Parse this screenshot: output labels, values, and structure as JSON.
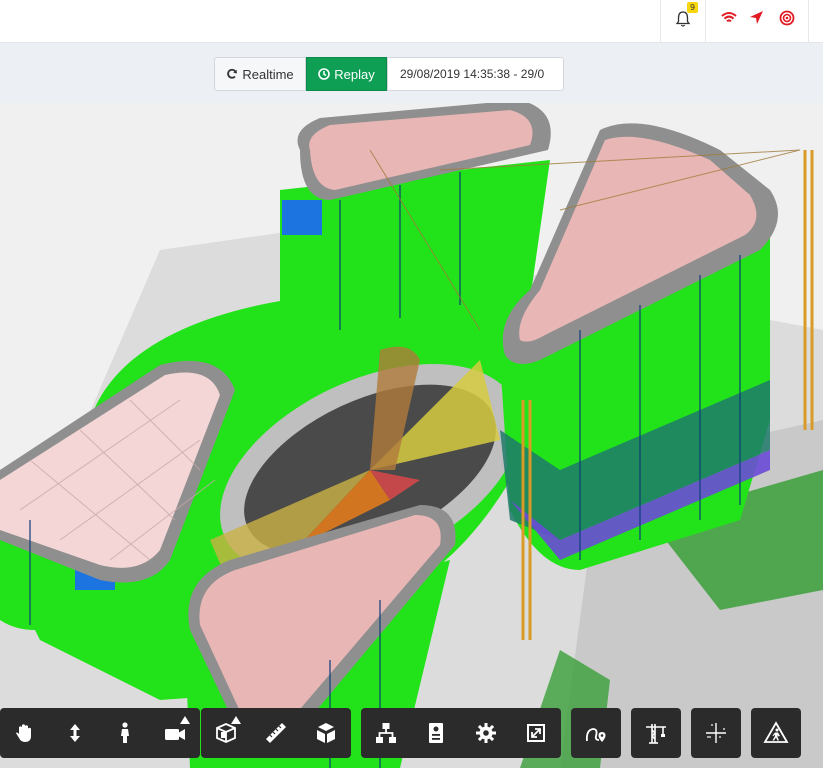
{
  "header": {
    "notification_count": "9",
    "icons": [
      "bell-icon",
      "wifi-icon",
      "navigation-arrow-icon",
      "target-icon"
    ],
    "accent_color": "#e01b24"
  },
  "timeline": {
    "realtime_label": "Realtime",
    "replay_label": "Replay",
    "date_range": "29/08/2019 14:35:38 - 29/0",
    "active": "replay",
    "active_color": "#0e9f55"
  },
  "viewport": {
    "description_icons": [
      "building-model"
    ],
    "colors": {
      "floor_green": "#22e31a",
      "roof_pink": "#e8b7b5",
      "glass_blue": "#1c74e0",
      "purple_band": "#6a4ad6",
      "crane_orange": "#d99a27",
      "ground_gray": "#d9d9d9"
    }
  },
  "toolbar": {
    "groups": [
      [
        "pan-hand-icon",
        "vertical-move-icon",
        "walk-person-icon",
        "camera-icon"
      ],
      [
        "section-box-icon",
        "ruler-icon",
        "explode-cube-icon"
      ],
      [
        "hierarchy-icon",
        "properties-icon",
        "settings-gear-icon",
        "fullscreen-icon"
      ],
      [
        "route-pin-icon"
      ],
      [
        "crane-icon"
      ],
      [
        "crosshair-axis-icon"
      ],
      [
        "warning-person-icon"
      ]
    ]
  }
}
